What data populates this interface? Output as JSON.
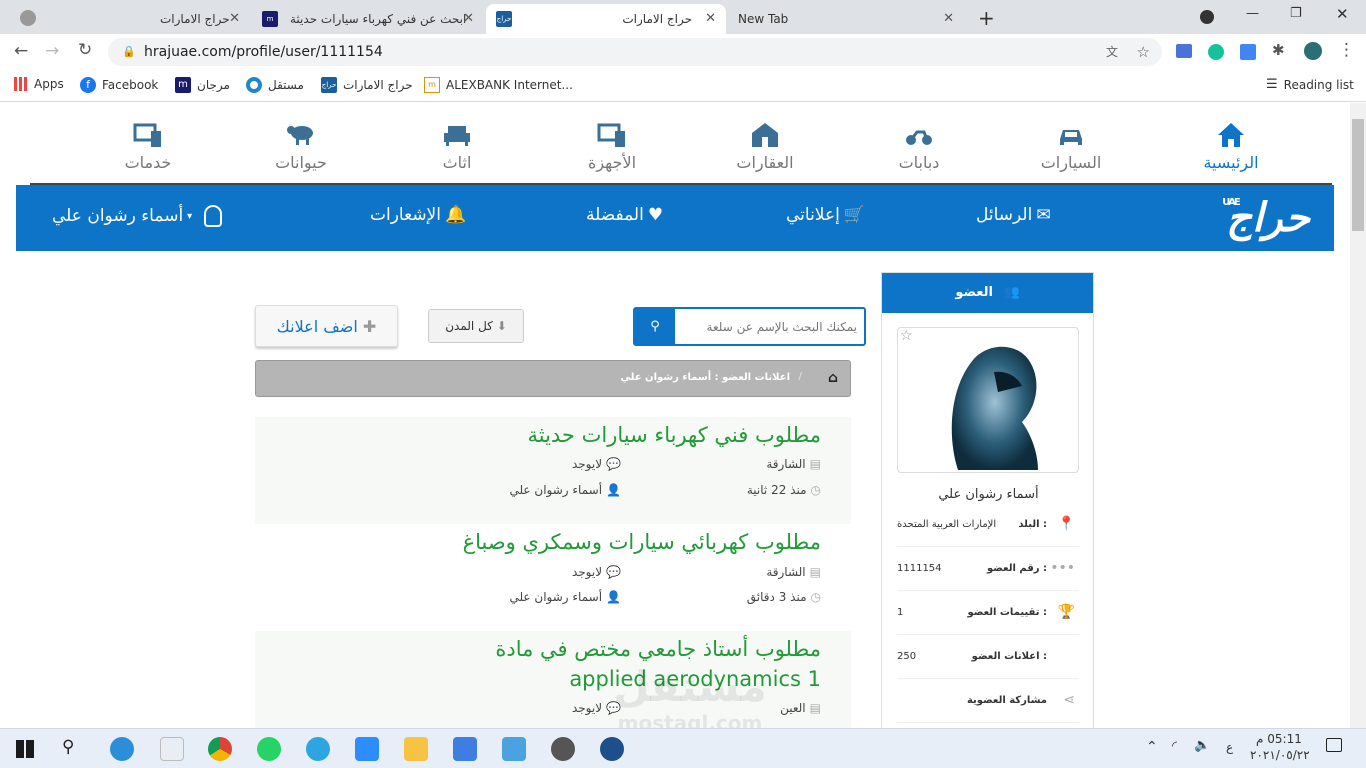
{
  "browser": {
    "tabs": [
      {
        "title": "حراج الامارات"
      },
      {
        "title": "ابحث عن فني كهرباء سيارات حديثة"
      },
      {
        "title": "حراج الامارات"
      },
      {
        "title": "New Tab"
      }
    ],
    "tab_icon_text": "حراج",
    "url": "hrajuae.com/profile/user/1111154",
    "bookmarks": [
      {
        "label": "Apps",
        "icon": "apps-grid-icon"
      },
      {
        "label": "Facebook",
        "icon": "facebook-icon"
      },
      {
        "label": "مرجان",
        "icon": "marjan-icon"
      },
      {
        "label": "مستقل",
        "icon": "mostaql-icon"
      },
      {
        "label": "حراج الامارات",
        "icon": "haraj-icon"
      },
      {
        "label": "ALEXBANK Internet...",
        "icon": "alexbank-icon"
      }
    ],
    "reading_list": "Reading list"
  },
  "site": {
    "categories": [
      "الرئيسية",
      "السيارات",
      "دبابات",
      "العقارات",
      "الأجهزة",
      "اثاث",
      "حيوانات",
      "خدمات"
    ],
    "logo_text": "حراج",
    "logo_badge": "UAE",
    "nav": {
      "messages": "الرسائل",
      "my_ads": "إعلاناتي",
      "favorites": "المفضلة",
      "notifications": "الإشعارات",
      "user": "أسماء رشوان علي"
    },
    "accent": "#0d74c7",
    "title_color": "#229a37"
  },
  "toolbar": {
    "search_placeholder": "يمكنك البحث بالإسم عن سلعة",
    "cities_label": "كل المدن",
    "add_ad_label": "اضف اعلانك"
  },
  "breadcrumb": {
    "label": "اعلانات العضو : أسماء رشوان علي"
  },
  "listings": [
    {
      "title": "مطلوب فني كهرباء سيارات حديثة",
      "city": "الشارقة",
      "comments": "لايوجد",
      "time": "منذ 22 ثانية",
      "author": "أسماء رشوان علي"
    },
    {
      "title": "مطلوب كهربائي سيارات وسمكري وصباغ",
      "city": "الشارقة",
      "comments": "لايوجد",
      "time": "منذ 3 دقائق",
      "author": "أسماء رشوان علي"
    },
    {
      "title": "مطلوب أستاذ جامعي مختص في مادة",
      "title2": "applied aerodynamics 1",
      "city": "العين",
      "comments": "لايوجد"
    }
  ],
  "member": {
    "heading": "العضو",
    "name": "أسماء رشوان علي",
    "rows": [
      {
        "label": "البلد :",
        "value": "الإمارات العربية المتحدة"
      },
      {
        "label": "رقم العضو :",
        "value": "1111154"
      },
      {
        "label": "تقييمات العضو :",
        "value": "1"
      },
      {
        "label": "اعلانات العضو :",
        "value": "250"
      },
      {
        "label": "مشاركة العضوية",
        "value": ""
      }
    ]
  },
  "watermark": {
    "ar": "مستقل",
    "en": "mostaql.com"
  },
  "taskbar": {
    "time": "05:11 م",
    "date": "٢٠٢١/٠٥/٢٢",
    "lang": "ع"
  }
}
